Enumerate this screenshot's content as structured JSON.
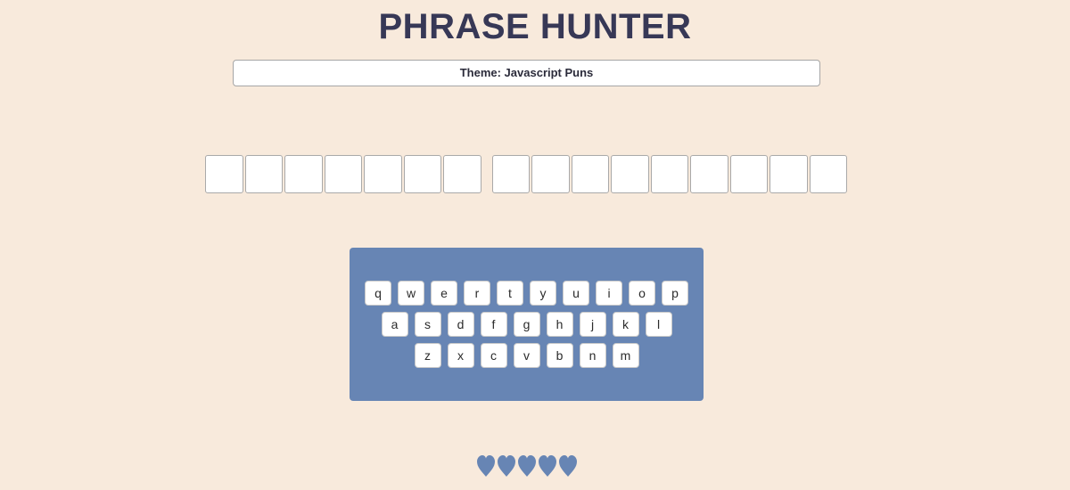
{
  "header": {
    "title": "PHRASE HUNTER"
  },
  "theme": {
    "label": "Theme: Javascript Puns"
  },
  "phrase": {
    "words": [
      7,
      9
    ]
  },
  "keyboard": {
    "rows": [
      [
        "q",
        "w",
        "e",
        "r",
        "t",
        "y",
        "u",
        "i",
        "o",
        "p"
      ],
      [
        "a",
        "s",
        "d",
        "f",
        "g",
        "h",
        "j",
        "k",
        "l"
      ],
      [
        "z",
        "x",
        "c",
        "v",
        "b",
        "n",
        "m"
      ]
    ]
  },
  "lives": {
    "count": 5,
    "icon": "heart-icon",
    "color": "#6785b4"
  },
  "colors": {
    "background": "#f8eadc",
    "title": "#373856",
    "keyboard_bg": "#6785b4"
  }
}
